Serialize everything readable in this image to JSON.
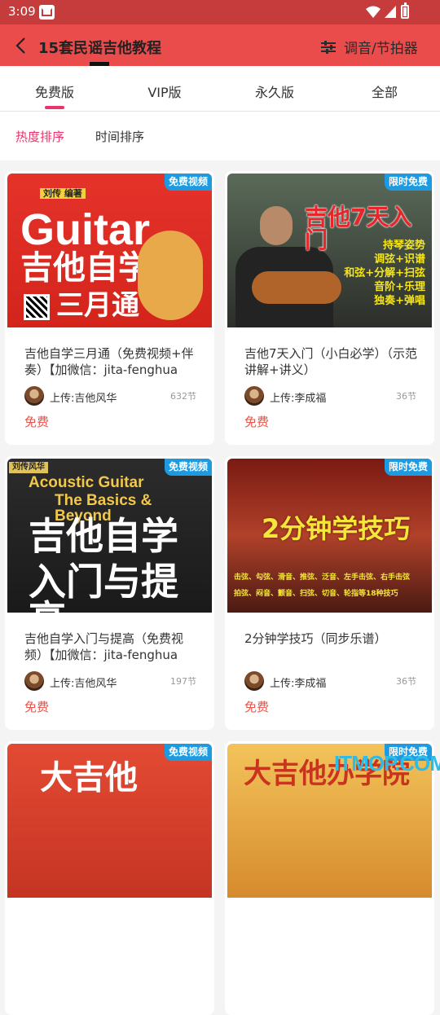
{
  "status_bar": {
    "time": "3:09"
  },
  "appbar": {
    "title": "15套民谣吉他教程",
    "tools_label": "调音/节拍器"
  },
  "tabs": [
    {
      "label": "免费版"
    },
    {
      "label": "VIP版"
    },
    {
      "label": "永久版"
    },
    {
      "label": "全部"
    }
  ],
  "sort": {
    "hot": "热度排序",
    "time": "时间排序"
  },
  "colors": {
    "accent": "#e8346a",
    "appbar": "#ea4c4c",
    "badge": "#1e9be0",
    "price": "#e8534a"
  },
  "cards": [
    {
      "badge": "免费视频",
      "title": "吉他自学三月通（免费视频+伴奏）【加微信：jita-fenghua免...",
      "uploader": "上传:吉他风华",
      "count": "632节",
      "price": "免费",
      "art_main": "Guitar",
      "art_sub": "吉他自学",
      "art_sub2": "三月通",
      "art_top": "刘传 编著"
    },
    {
      "badge": "限时免费",
      "title": "吉他7天入门（小白必学）（示范讲解+讲义）",
      "uploader": "上传:李成福",
      "count": "36节",
      "price": "免费",
      "art_main": "吉他7天入门",
      "art_lines": [
        "持琴姿势",
        "调弦+识谱",
        "和弦+分解+扫弦",
        "音阶+乐理",
        "独奏+弹唱"
      ]
    },
    {
      "badge": "免费视频",
      "title": " 吉他自学入门与提高（免费视频）【加微信：jita-fenghua免...",
      "uploader": "上传:吉他风华",
      "count": "197节",
      "price": "免费",
      "art_top": "刘传风华",
      "art_en1": "Acoustic Guitar",
      "art_en2": "The Basics & Beyond",
      "art_main": "吉他自学",
      "art_sub": "入门与提高"
    },
    {
      "badge": "限时免费",
      "title": "2分钟学技巧（同步乐谱）",
      "uploader": "上传:李成福",
      "count": "36节",
      "price": "免费",
      "art_main": "2分钟学技巧",
      "art_line1": "击弦、勾弦、滑音、推弦、泛音、左手击弦、右手击弦",
      "art_line2": "拍弦、闷音、颤音、扫弦、切音、轮指等18种技巧"
    },
    {
      "badge": "免费视频",
      "art_text": "大吉他"
    },
    {
      "badge": "限时免费",
      "art_text": "大吉他办学院"
    }
  ],
  "watermark": "ITMOP.COM"
}
